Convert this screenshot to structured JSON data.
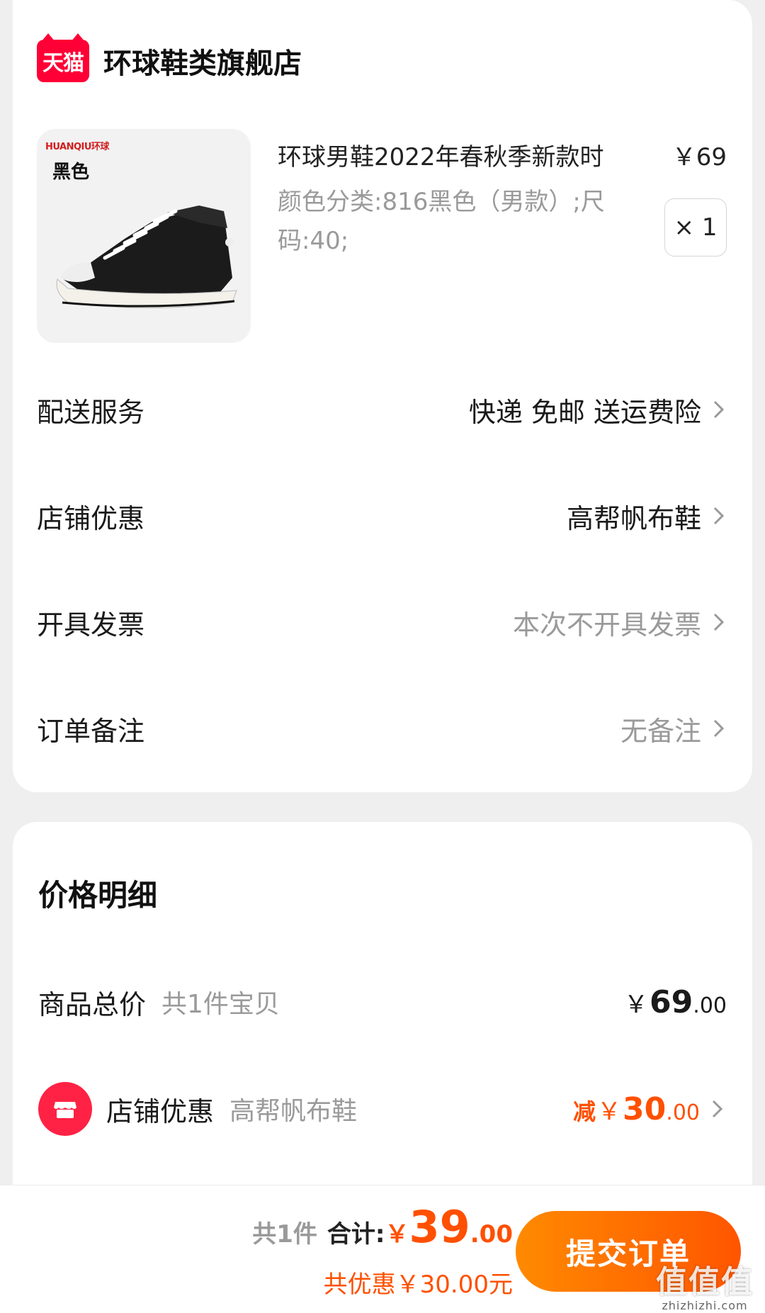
{
  "store": {
    "logo_text": "天猫",
    "name": "环球鞋类旗舰店"
  },
  "product": {
    "thumb_brand": "HUANQIU环球",
    "thumb_color": "黑色",
    "title": "环球男鞋2022年春秋季新款时",
    "price": "￥69",
    "spec": "颜色分类:816黑色（男款）;尺码:40;",
    "quantity": "× 1"
  },
  "options": {
    "delivery": {
      "label": "配送服务",
      "value": "快递 免邮 送运费险"
    },
    "shop_discount": {
      "label": "店铺优惠",
      "value": "高帮帆布鞋"
    },
    "invoice": {
      "label": "开具发票",
      "value": "本次不开具发票"
    },
    "note": {
      "label": "订单备注",
      "value": "无备注"
    }
  },
  "price_detail": {
    "title": "价格明细",
    "goods_total": {
      "label": "商品总价",
      "sub": "共1件宝贝",
      "symbol": "￥",
      "int": "69",
      "dec": ".00"
    },
    "shop_discount": {
      "label": "店铺优惠",
      "sub": "高帮帆布鞋",
      "prefix": "减",
      "symbol": "￥",
      "int": "30",
      "dec": ".00"
    }
  },
  "bottom": {
    "count": "共1件",
    "total_label": "合计:",
    "symbol": "￥",
    "int": "39",
    "dec": ".00",
    "saving": "共优惠￥30.00元",
    "submit": "提交订单"
  },
  "watermark": {
    "main": "值值值",
    "sub": "zhizhizhi.com"
  },
  "colors": {
    "accent": "#ff5000",
    "tmall_red": "#ff0036",
    "button_start": "#ff8a00",
    "button_end": "#ff5500"
  }
}
